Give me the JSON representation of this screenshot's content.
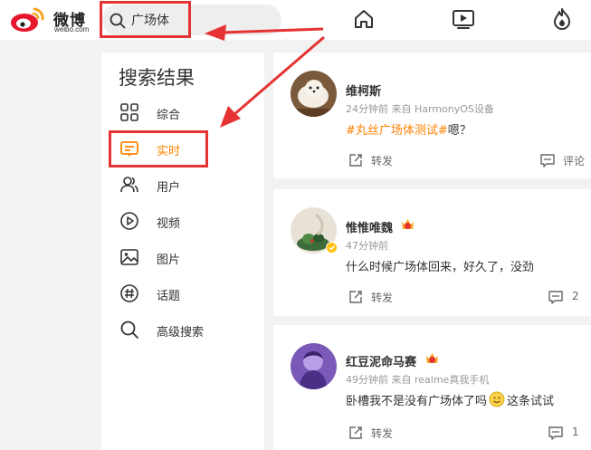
{
  "logo": {
    "brand": "微博",
    "domain": "weibo.com"
  },
  "search": {
    "value": "广场体"
  },
  "sidebar": {
    "title": "搜索结果",
    "items": [
      {
        "label": "综合",
        "icon": "grid-icon"
      },
      {
        "label": "实时",
        "icon": "realtime-icon"
      },
      {
        "label": "用户",
        "icon": "users-icon"
      },
      {
        "label": "视频",
        "icon": "play-icon"
      },
      {
        "label": "图片",
        "icon": "image-icon"
      },
      {
        "label": "话题",
        "icon": "hashtag-icon"
      },
      {
        "label": "高级搜索",
        "icon": "search-icon"
      }
    ]
  },
  "posts": [
    {
      "user": "维柯斯",
      "meta": "24分钟前  来自 HarmonyOS设备",
      "tag": "#丸丝广场体测试#",
      "text": "嗯？",
      "repost": "转发",
      "comment": "评论"
    },
    {
      "user": "惟惟唯魏",
      "meta": "47分钟前",
      "text": "什么时候广场体回来，好久了，没劲",
      "repost": "转发",
      "comment": "2"
    },
    {
      "user": "红豆泥命马赛",
      "meta": "49分钟前  来自 realme真我手机",
      "text": "卧槽我不是没有广场体了吗",
      "text2": "这条试试",
      "repost": "转发",
      "comment": "1"
    }
  ],
  "colors": {
    "accent": "#ff8200",
    "annotation": "#e53333",
    "brand_red": "#e6162d"
  }
}
